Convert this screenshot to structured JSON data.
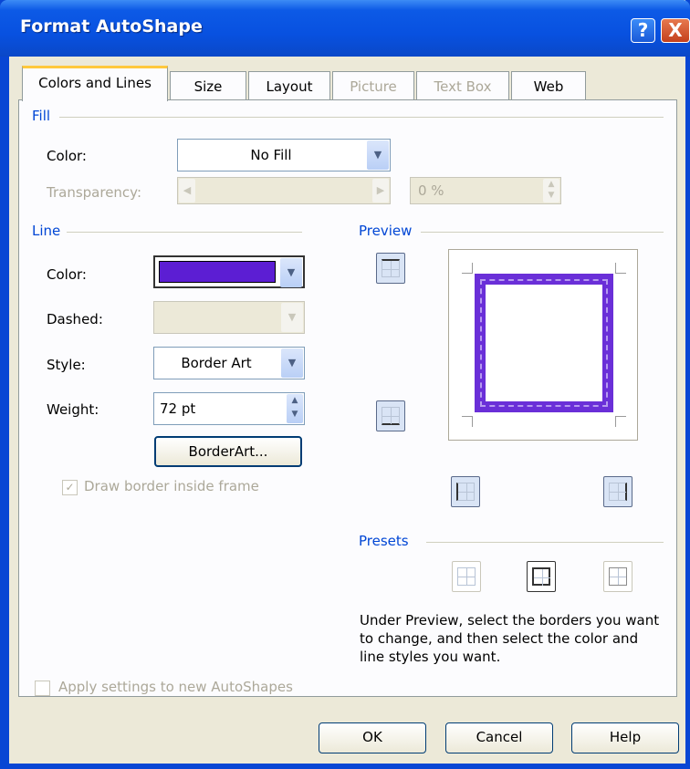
{
  "window": {
    "title": "Format AutoShape",
    "help_glyph": "?",
    "close_glyph": "X"
  },
  "tabs": [
    {
      "label": "Colors and Lines",
      "state": "active"
    },
    {
      "label": "Size",
      "state": "enabled"
    },
    {
      "label": "Layout",
      "state": "enabled"
    },
    {
      "label": "Picture",
      "state": "disabled"
    },
    {
      "label": "Text Box",
      "state": "disabled"
    },
    {
      "label": "Web",
      "state": "enabled"
    }
  ],
  "fill": {
    "group_label": "Fill",
    "color_label": "Color:",
    "color_value": "No Fill",
    "transparency_label": "Transparency:",
    "transparency_value": "0 %"
  },
  "line": {
    "group_label": "Line",
    "color_label": "Color:",
    "color_swatch": "#5c1ed3",
    "dashed_label": "Dashed:",
    "dashed_value": "",
    "style_label": "Style:",
    "style_value": "Border Art",
    "weight_label": "Weight:",
    "weight_value": "72 pt",
    "borderart_button": "BorderArt...",
    "draw_inside_label": "Draw border inside frame",
    "draw_inside_checked": true
  },
  "preview": {
    "group_label": "Preview",
    "border_color": "#6a2fd8"
  },
  "presets": {
    "group_label": "Presets",
    "help_text": "Under Preview, select the borders you want to change, and then select the color and line styles you want."
  },
  "apply_label": "Apply settings to new AutoShapes",
  "buttons": {
    "ok": "OK",
    "cancel": "Cancel",
    "help": "Help"
  }
}
